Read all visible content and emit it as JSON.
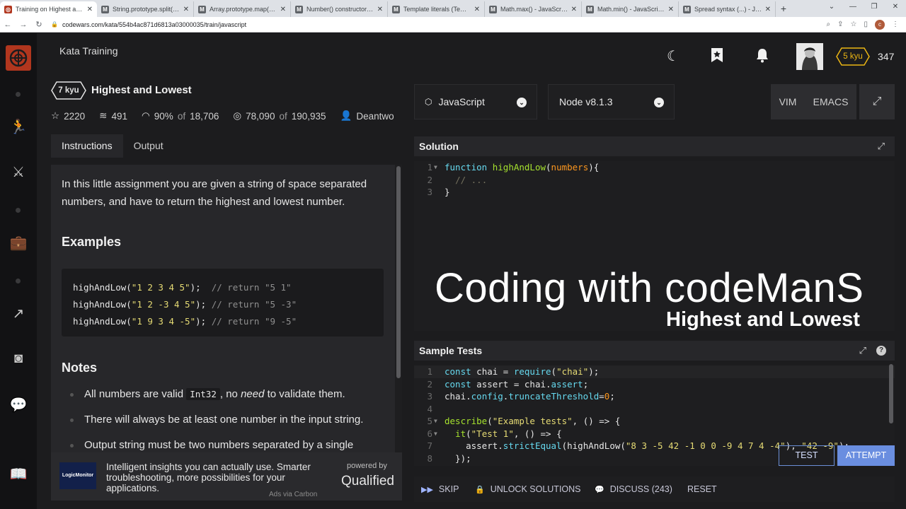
{
  "browser": {
    "tabs": [
      {
        "label": "Training on Highest and Lo",
        "icon": "codewars-icon",
        "active": true
      },
      {
        "label": "String.prototype.split() - Ja",
        "icon": "mdn-icon"
      },
      {
        "label": "Array.prototype.map() - Ja",
        "icon": "mdn-icon"
      },
      {
        "label": "Number() constructor - Ja",
        "icon": "mdn-icon"
      },
      {
        "label": "Template literals (Template",
        "icon": "mdn-icon"
      },
      {
        "label": "Math.max() - JavaScript | M",
        "icon": "mdn-icon"
      },
      {
        "label": "Math.min() - JavaScript | M",
        "icon": "mdn-icon"
      },
      {
        "label": "Spread syntax (...) - JavaSc",
        "icon": "mdn-icon"
      }
    ],
    "url": "codewars.com/kata/554b4ac871d6813a03000035/train/javascript",
    "profile_initial": "c"
  },
  "header": {
    "title": "Kata Training",
    "kyu_badge": "5 kyu",
    "honor": "347"
  },
  "kata": {
    "rank": "7 kyu",
    "title": "Highest and Lowest",
    "stats": {
      "stars": "2220",
      "collections": "491",
      "satisfaction": "90%",
      "of_label": "of",
      "votes": "18,706",
      "completed": "78,090",
      "attempted": "190,935",
      "author": "Deantwo"
    },
    "tabs": [
      "Instructions",
      "Output"
    ],
    "description": "In this little assignment you are given a string of space separated numbers, and have to return the highest and lowest number.",
    "examples_heading": "Examples",
    "examples": [
      {
        "call": "highAndLow(",
        "arg": "\"1 2 3 4 5\"",
        "close": ");  ",
        "comment": "// return \"5 1\""
      },
      {
        "call": "highAndLow(",
        "arg": "\"1 2 -3 4 5\"",
        "close": "); ",
        "comment": "// return \"5 -3\""
      },
      {
        "call": "highAndLow(",
        "arg": "\"1 9 3 4 -5\"",
        "close": "); ",
        "comment": "// return \"9 -5\""
      }
    ],
    "notes_heading": "Notes",
    "notes": {
      "n1_a": "All numbers are valid ",
      "n1_code": "Int32",
      "n1_b": ", no ",
      "n1_em": "need",
      "n1_c": " to validate them.",
      "n2": "There will always be at least one number in the input string.",
      "n3": "Output string must be two numbers separated by a single"
    }
  },
  "ad": {
    "logo_text": "LogicMonitor",
    "text": "Intelligent insights you can actually use. Smarter troubleshooting, more possibilities for your applications.",
    "via": "Ads via Carbon",
    "powered_by": "powered by",
    "brand": "Qualified"
  },
  "editor": {
    "language": "JavaScript",
    "version": "Node v8.1.3",
    "modes": [
      "VIM",
      "EMACS"
    ],
    "solution_title": "Solution",
    "tests_title": "Sample Tests",
    "solution_lines": [
      "1",
      "2",
      "3"
    ],
    "test_lines": [
      "1",
      "2",
      "3",
      "4",
      "5",
      "6",
      "7",
      "8"
    ]
  },
  "overlay": {
    "big": "Coding with codeManS",
    "small": "Highest and Lowest"
  },
  "actions": {
    "skip": "SKIP",
    "unlock": "UNLOCK SOLUTIONS",
    "discuss": "DISCUSS (243)",
    "reset": "RESET",
    "test": "TEST",
    "attempt": "ATTEMPT"
  },
  "colors": {
    "brand": "#b1361e",
    "rank_badge": "#e5e5e5",
    "kyu_badge": "#ecb613",
    "attempt": "#6a8ee0"
  }
}
